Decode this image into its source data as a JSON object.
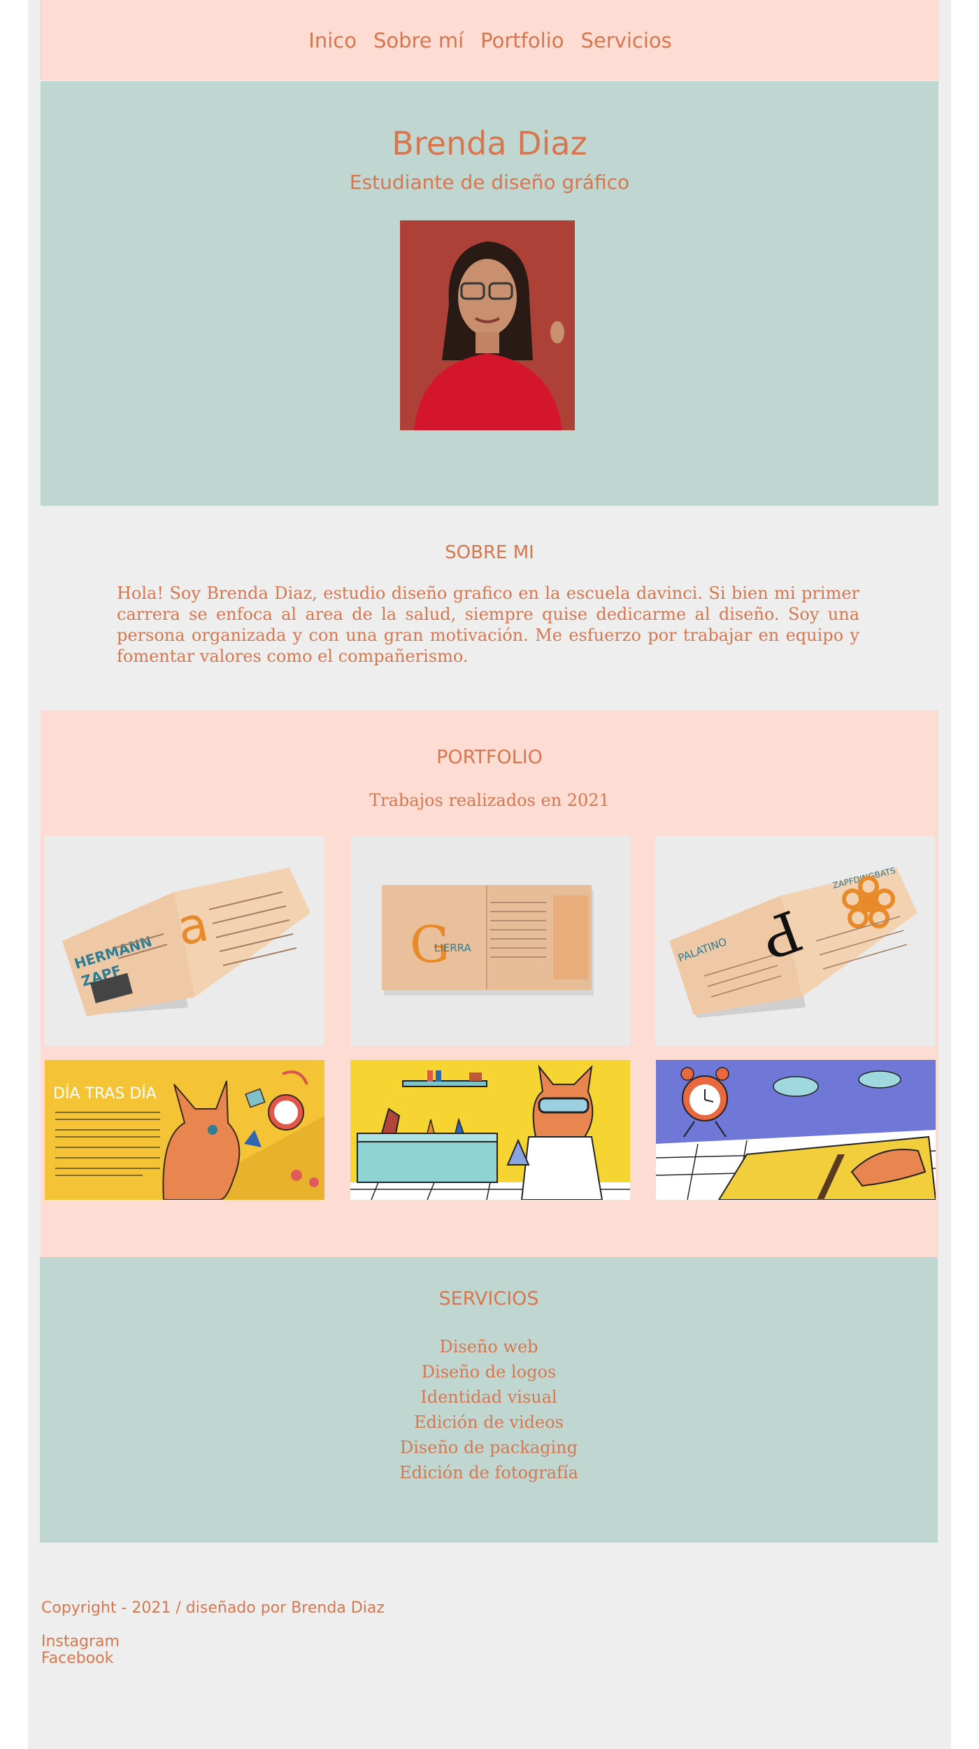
{
  "nav": {
    "items": [
      "Inico",
      "Sobre mí",
      "Portfolio",
      "Servicios"
    ]
  },
  "hero": {
    "name": "Brenda Diaz",
    "role": "Estudiante de diseño gráfico"
  },
  "about": {
    "title": "SOBRE MI",
    "text": "Hola! Soy Brenda Diaz, estudio diseño grafico en la escuela davinci. Si bien mi primer carrera se enfoca al area de la salud, siempre quise dedicarme al diseño. Soy una persona organizada y con una gran motivación. Me esfuerzo por trabajar en equipo y fomentar valores como el compañerismo."
  },
  "portfolio": {
    "title": "PORTFOLIO",
    "subtitle": "Trabajos realizados en 2021",
    "works": [
      {
        "label_1": "HERMANN",
        "label_2": "ZAPF",
        "glyph": "a"
      },
      {
        "label_1": "LIERRA",
        "glyph": "G"
      },
      {
        "label_1": "PALATINO",
        "label_2": "ZAPFDINGBATS",
        "glyph": "P"
      },
      {
        "label_1": "DÍA TRAS DÍA"
      },
      {},
      {}
    ]
  },
  "services": {
    "title": "SERVICIOS",
    "items": [
      "Diseño web",
      "Diseño de logos",
      "Identidad visual",
      "Edición de videos",
      "Diseño de packaging",
      "Edición de fotografía"
    ]
  },
  "footer": {
    "copyright": "Copyright - 2021 / diseñado por Brenda Diaz",
    "links": [
      "Instagram",
      "Facebook"
    ]
  },
  "colors": {
    "accent": "#d7774f",
    "peach": "#fddcd3",
    "sage": "#bfd6d1",
    "page": "#eeeeee"
  }
}
